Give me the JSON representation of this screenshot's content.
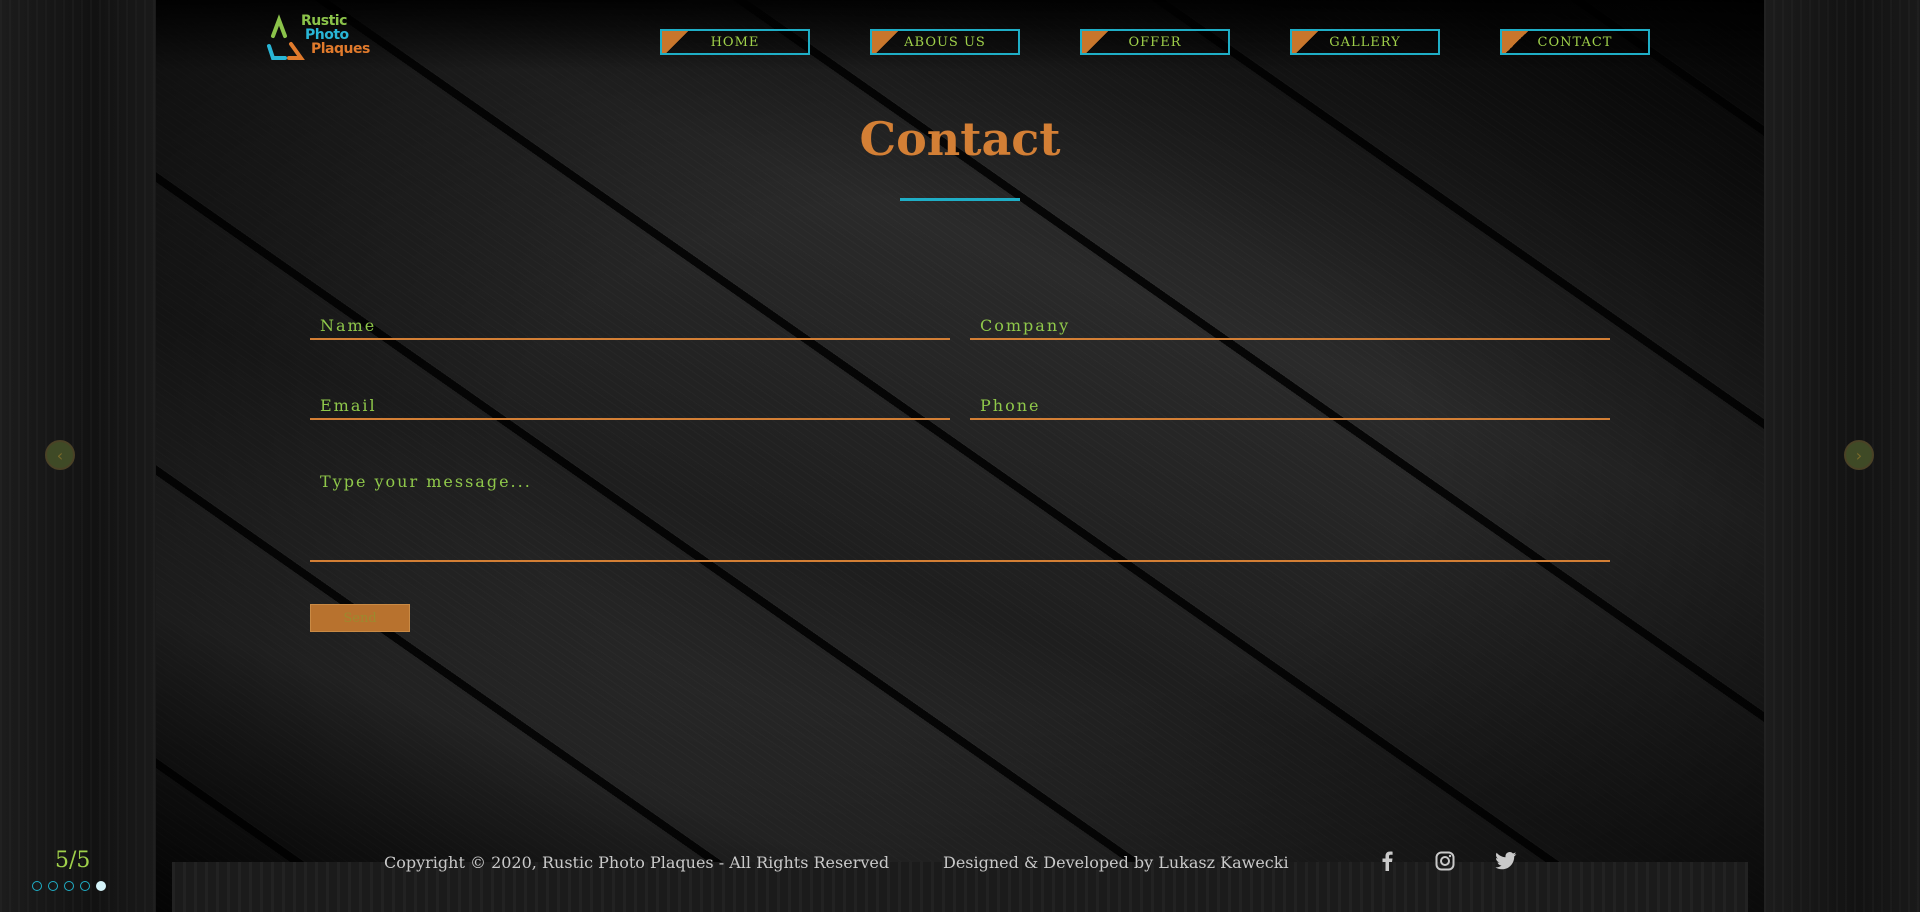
{
  "logo": {
    "line1": "Rustic",
    "line2": "Photo",
    "line3": "Plaques"
  },
  "nav": [
    {
      "label": "HOME"
    },
    {
      "label": "ABOUS US"
    },
    {
      "label": "OFFER"
    },
    {
      "label": "GALLERY"
    },
    {
      "label": "CONTACT"
    }
  ],
  "page": {
    "title": "Contact"
  },
  "form": {
    "name_placeholder": "Name",
    "company_placeholder": "Company",
    "email_placeholder": "Email",
    "phone_placeholder": "Phone",
    "message_placeholder": "Type your message...",
    "send_label": "Send"
  },
  "slider": {
    "arrow_left": "‹",
    "arrow_right": "›",
    "counter": "5/5",
    "total": 5,
    "current": 5
  },
  "footer": {
    "copyright": "Copyright © 2020, Rustic Photo Plaques - All Rights Reserved",
    "designed_by": "Designed & Developed by Lukasz Kawecki",
    "social_icons": [
      "facebook-icon",
      "instagram-icon",
      "twitter-icon"
    ]
  },
  "colors": {
    "accent_orange": "#d37f35",
    "accent_blue": "#1faec6",
    "accent_green": "#9fd04a"
  }
}
